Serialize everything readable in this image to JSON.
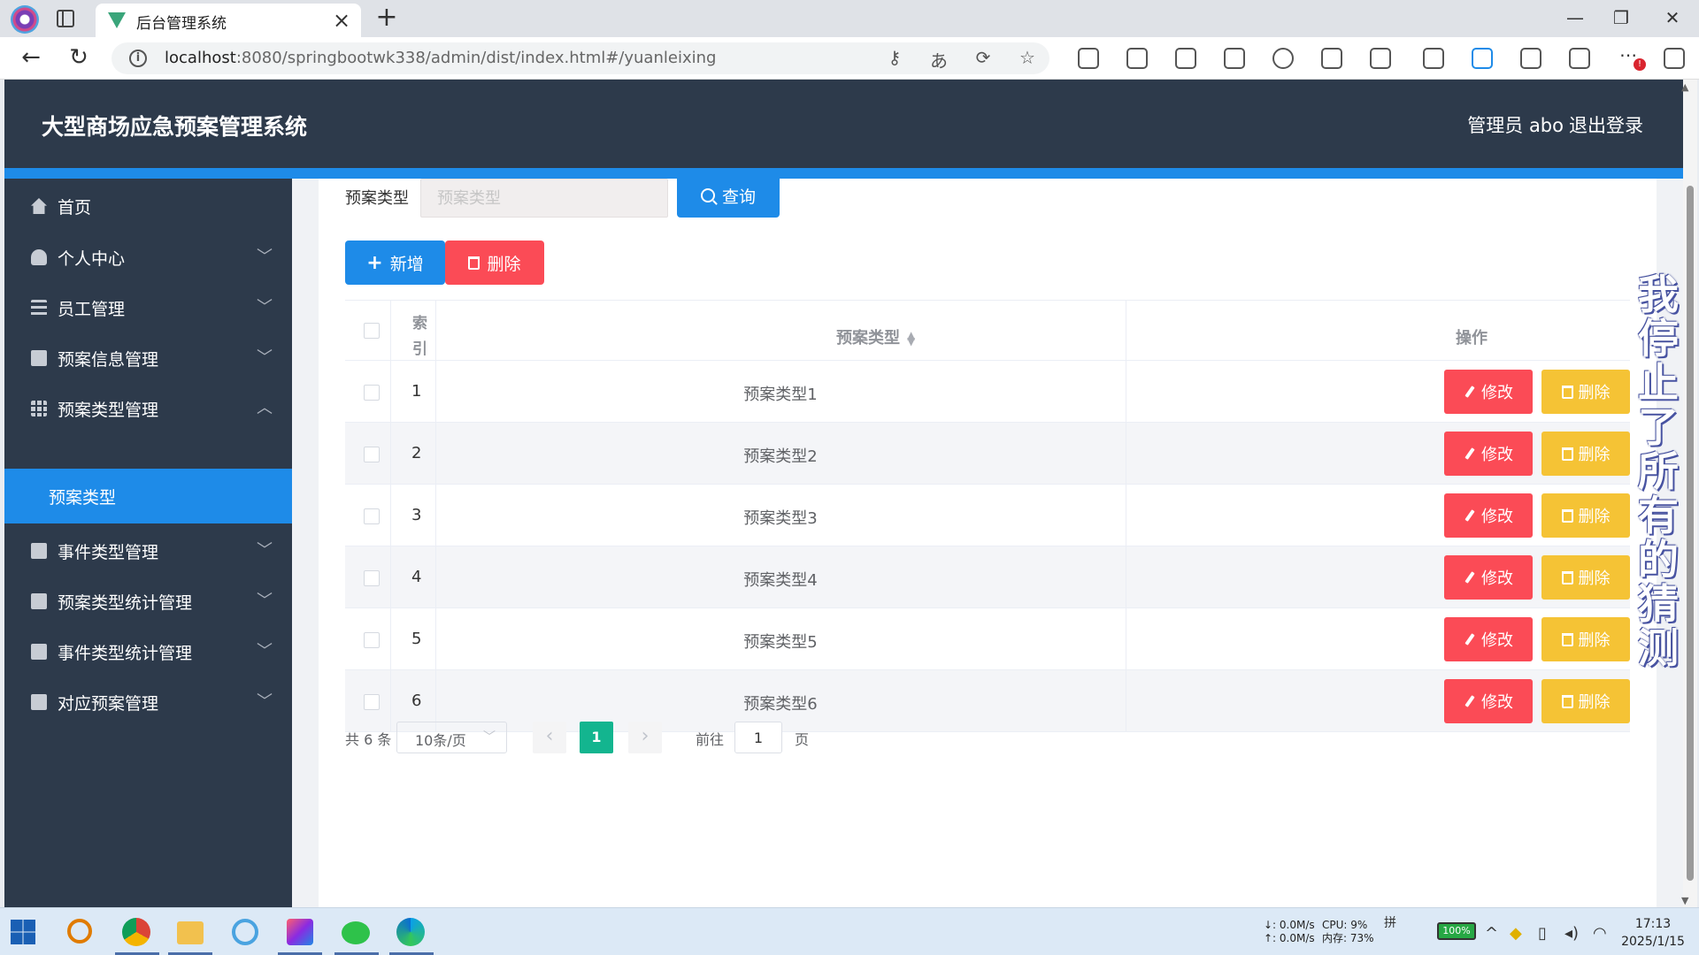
{
  "browser": {
    "tab_title": "后台管理系统",
    "url_host": "localhost",
    "url_path": ":8080/springbootwk338/admin/dist/index.html#/yuanleixing"
  },
  "header": {
    "title": "大型商场应急预案管理系统",
    "user": "管理员 abo",
    "logout": "退出登录"
  },
  "sidebar": {
    "items": [
      {
        "label": "首页",
        "icon": "home-icon",
        "caret": ""
      },
      {
        "label": "个人中心",
        "icon": "user-icon",
        "caret": "﹀"
      },
      {
        "label": "员工管理",
        "icon": "sliders-icon",
        "caret": "﹀"
      },
      {
        "label": "预案信息管理",
        "icon": "folder-icon",
        "caret": "﹀"
      },
      {
        "label": "预案类型管理",
        "icon": "grid-icon",
        "caret": "︿"
      },
      {
        "label": "事件类型管理",
        "icon": "briefcase-icon",
        "caret": "﹀"
      },
      {
        "label": "预案类型统计管理",
        "icon": "clipboard-check-icon",
        "caret": "﹀"
      },
      {
        "label": "事件类型统计管理",
        "icon": "monitor-icon",
        "caret": "﹀"
      },
      {
        "label": "对应预案管理",
        "icon": "clipboard-x-icon",
        "caret": "﹀"
      }
    ],
    "active_sub": "预案类型"
  },
  "search": {
    "label": "预案类型",
    "placeholder": "预案类型",
    "value": "",
    "query_label": "查询"
  },
  "actions": {
    "add_label": "新增",
    "delete_label": "删除"
  },
  "table": {
    "headers": {
      "index": "索引",
      "type": "预案类型",
      "ops": "操作"
    },
    "rows": [
      {
        "index": "1",
        "type": "预案类型1"
      },
      {
        "index": "2",
        "type": "预案类型2"
      },
      {
        "index": "3",
        "type": "预案类型3"
      },
      {
        "index": "4",
        "type": "预案类型4"
      },
      {
        "index": "5",
        "type": "预案类型5"
      },
      {
        "index": "6",
        "type": "预案类型6"
      }
    ],
    "edit_label": "修改",
    "delete_label": "删除"
  },
  "pagination": {
    "total": "共 6 条",
    "page_size": "10条/页",
    "current_page": "1",
    "goto_label": "前往",
    "goto_value": "1",
    "page_unit": "页"
  },
  "overlay_text": "我停止了所有的猜测",
  "taskbar": {
    "net_down": "↓: 0.0M/s",
    "net_up": "↑: 0.0M/s",
    "cpu": "CPU: 9%",
    "mem": "内存: 73%",
    "battery": "100%",
    "time": "17:13",
    "date": "2025/1/15"
  },
  "colors": {
    "primary": "#1e8be8",
    "danger": "#fb4b56",
    "warning": "#f5c335",
    "sidebar": "#2d3a4b",
    "pager_active": "#13b58f"
  }
}
